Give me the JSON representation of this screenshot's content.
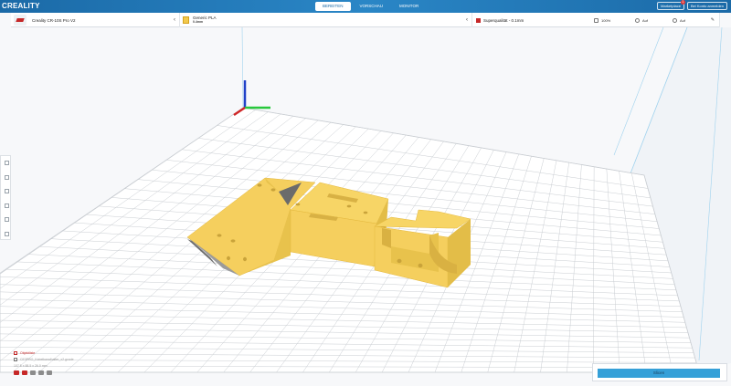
{
  "app": {
    "logo": "CREALITY"
  },
  "stages": [
    {
      "label": "BEREITEN",
      "active": true
    },
    {
      "label": "VORSCHAU",
      "active": false
    },
    {
      "label": "MONITOR",
      "active": false
    }
  ],
  "header_buttons": {
    "marketplace": "Marketplace",
    "sign_in": "Bei Konto anmelden",
    "marketplace_badge": "1"
  },
  "printer": {
    "name": "Creality CR-10S Pro V2",
    "icon": "printer-icon"
  },
  "material": {
    "name": "Generic PLA",
    "nozzle": "0.4mm",
    "color": "#f2c94c"
  },
  "print_settings": {
    "profile": "Superqualität - 0.1mm",
    "infill": "100%",
    "support": "Auf",
    "adhesion": "Auf"
  },
  "colors": {
    "accent": "#2a86c6",
    "model": "#f5cf5e",
    "slice_button": "#35a0d8"
  },
  "tools": [
    "move-icon",
    "scale-icon",
    "rotate-icon",
    "mirror-icon",
    "per-model-settings-icon",
    "support-blocker-icon"
  ],
  "object_list": {
    "header": "Objektliste",
    "item": "CE3PRO_Kabelkanalhalter_x2.gcode",
    "dimensions": "107.5 x 88.5 x 26.0 mm"
  },
  "slice_panel": {
    "button_label": "Slicen"
  }
}
